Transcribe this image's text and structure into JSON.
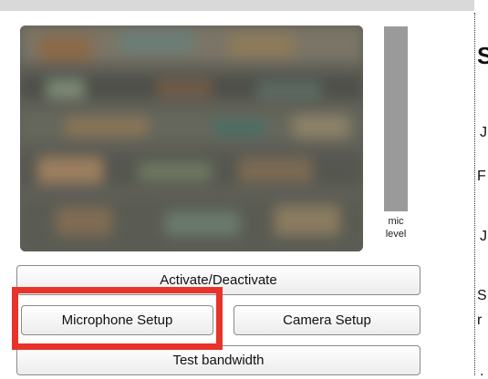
{
  "mic_meter": {
    "label": "mic\nlevel",
    "level": 0.0
  },
  "buttons": {
    "activate_label": "Activate/Deactivate",
    "microphone_setup_label": "Microphone Setup",
    "camera_setup_label": "Camera Setup",
    "test_bandwidth_label": "Test bandwidth"
  },
  "highlight": {
    "color": "#e8332a",
    "target": "Microphone Setup"
  },
  "right_panel_glyphs": [
    "S",
    "J",
    "F",
    "J",
    "S",
    "r",
    "."
  ]
}
